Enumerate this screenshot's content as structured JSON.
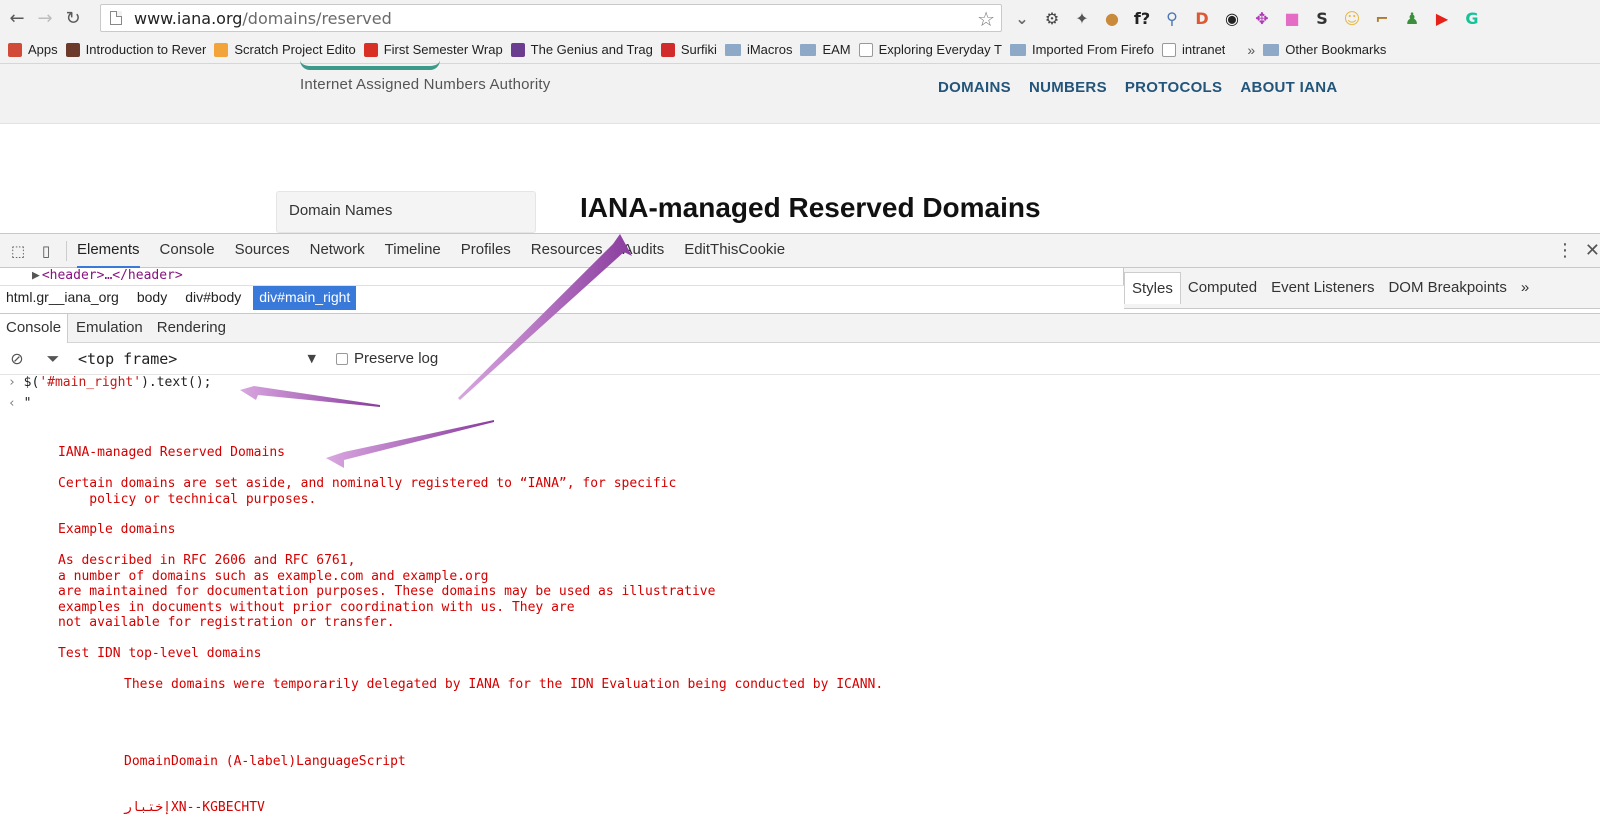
{
  "browser": {
    "url_host": "www.iana.org",
    "url_path": "/domains/reserved",
    "extensions": [
      {
        "icon": "pocket-icon",
        "color": "#6b6b6b",
        "glyph": "⌄"
      },
      {
        "icon": "gear-icon",
        "color": "#444444",
        "glyph": "⚙"
      },
      {
        "icon": "puzzle-icon",
        "color": "#555555",
        "glyph": "✦"
      },
      {
        "icon": "cookie-icon",
        "color": "#c98a3b",
        "glyph": "●"
      },
      {
        "icon": "function-icon",
        "color": "#222222",
        "glyph": "f?"
      },
      {
        "icon": "magnifier-icon",
        "color": "#4a77b4",
        "glyph": "⚲"
      },
      {
        "icon": "duckduckgo-icon",
        "color": "#de5833",
        "glyph": "D"
      },
      {
        "icon": "chrome-dark-icon",
        "color": "#222222",
        "glyph": "◉"
      },
      {
        "icon": "cross-arrows-icon",
        "color": "#b03ab8",
        "glyph": "✥"
      },
      {
        "icon": "gradient-square-icon",
        "color": "#e46cc5",
        "glyph": "■"
      },
      {
        "icon": "s-icon",
        "color": "#333333",
        "glyph": "S"
      },
      {
        "icon": "emoji-icon",
        "color": "#e6b94a",
        "glyph": "☺"
      },
      {
        "icon": "brush-icon",
        "color": "#b07a2a",
        "glyph": "⌐"
      },
      {
        "icon": "people-icon",
        "color": "#3a8f3a",
        "glyph": "♟"
      },
      {
        "icon": "youtube-icon",
        "color": "#e62117",
        "glyph": "▶"
      },
      {
        "icon": "grammarly-icon",
        "color": "#15c39a",
        "glyph": "G"
      }
    ],
    "bookmarks": [
      {
        "label": "Apps",
        "icon": "apps-grid-icon",
        "color": "#d04a37"
      },
      {
        "label": "Introduction to Rever",
        "icon": "star-bookmark-icon",
        "color": "#6b3a2a"
      },
      {
        "label": "Scratch Project Edito",
        "icon": "scratch-icon",
        "color": "#f2a33a"
      },
      {
        "label": "First Semester Wrap",
        "icon": "gmail-icon",
        "color": "#d93025"
      },
      {
        "label": "The Genius and Trag",
        "icon": "s-circle-icon",
        "color": "#6a3d8f"
      },
      {
        "label": "Surfiki",
        "icon": "surfiki-icon",
        "color": "#d12b2b"
      },
      {
        "label": "iMacros",
        "icon": "folder-icon",
        "color": "#8ea9c8"
      },
      {
        "label": "EAM",
        "icon": "folder-icon",
        "color": "#8ea9c8"
      },
      {
        "label": "Exploring Everyday T",
        "icon": "page-icon",
        "color": "#999999"
      },
      {
        "label": "Imported From Firefo",
        "icon": "folder-icon",
        "color": "#8ea9c8"
      },
      {
        "label": "intranet",
        "icon": "page-icon",
        "color": "#999999"
      }
    ],
    "more_glyph": "»",
    "other_bookmarks": "Other Bookmarks"
  },
  "site": {
    "tagline": "Internet Assigned Numbers Authority",
    "nav": [
      "DOMAINS",
      "NUMBERS",
      "PROTOCOLS",
      "ABOUT IANA"
    ],
    "sidebar_first": "Domain Names",
    "page_title": "IANA-managed Reserved Domains"
  },
  "devtools": {
    "tabs": [
      "Elements",
      "Console",
      "Sources",
      "Network",
      "Timeline",
      "Profiles",
      "Resources",
      "Audits",
      "EditThisCookie"
    ],
    "active_tab": "Elements",
    "dom_line": "<header>…</header>",
    "breadcrumbs": [
      "html.gr__iana_org",
      "body",
      "div#body",
      "div#main_right"
    ],
    "selected_crumb": "div#main_right",
    "side_tabs": [
      "Styles",
      "Computed",
      "Event Listeners",
      "DOM Breakpoints"
    ],
    "side_more": "»",
    "drawer_tabs": [
      "Console",
      "Emulation",
      "Rendering"
    ],
    "frame": "<top frame>",
    "preserve_log": "Preserve log"
  },
  "console": {
    "input_prompt": "›",
    "input_prefix": "$(",
    "input_string": "'#main_right'",
    "input_suffix": ").text();",
    "result_prompt": "‹",
    "result_quote": "\"",
    "output": [
      {
        "text": "IANA-managed Reserved Domains",
        "indent": 0
      },
      {
        "text": "Certain domains are set aside, and nominally registered to “IANA”, for specific",
        "indent": 0
      },
      {
        "text": "    policy or technical purposes.",
        "indent": 0
      },
      {
        "text": "Example domains",
        "indent": 0
      },
      {
        "text": "As described in RFC 2606 and RFC 6761,",
        "indent": 0
      },
      {
        "text": "a number of domains such as example.com and example.org",
        "indent": 0
      },
      {
        "text": "are maintained for documentation purposes. These domains may be used as illustrative",
        "indent": 0
      },
      {
        "text": "examples in documents without prior coordination with us. They are",
        "indent": 0
      },
      {
        "text": "not available for registration or transfer.",
        "indent": 0
      },
      {
        "text": "Test IDN top-level domains",
        "indent": 0
      },
      {
        "text": "These domains were temporarily delegated by IANA for the IDN Evaluation being conducted by ICANN.",
        "indent": 1
      },
      {
        "text": "DomainDomain (A-label)LanguageScript",
        "indent": 1
      },
      {
        "text": "إختبارXN--KGBECHTV",
        "indent": 1
      }
    ]
  },
  "annotation_color": "#9b4fb0"
}
